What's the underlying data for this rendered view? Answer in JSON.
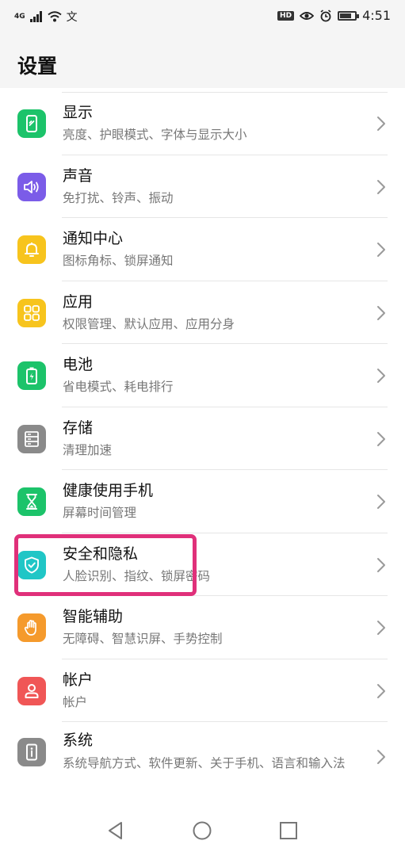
{
  "status_bar": {
    "network": "4G",
    "time": "4:51",
    "hd_label": "HD",
    "battery_level": 0.75,
    "icons": [
      "signal-icon",
      "wifi-icon",
      "translate-icon",
      "eye-icon",
      "alarm-icon",
      "battery-icon"
    ]
  },
  "header": {
    "title": "设置"
  },
  "settings": [
    {
      "id": "display",
      "title": "显示",
      "subtitle": "亮度、护眼模式、字体与显示大小",
      "icon": "display-icon",
      "color": "#1cc36a"
    },
    {
      "id": "sound",
      "title": "声音",
      "subtitle": "免打扰、铃声、振动",
      "icon": "speaker-icon",
      "color": "#7b5ce8"
    },
    {
      "id": "notify",
      "title": "通知中心",
      "subtitle": "图标角标、锁屏通知",
      "icon": "bell-icon",
      "color": "#f7c41d"
    },
    {
      "id": "apps",
      "title": "应用",
      "subtitle": "权限管理、默认应用、应用分身",
      "icon": "apps-grid-icon",
      "color": "#f7c41d"
    },
    {
      "id": "battery",
      "title": "电池",
      "subtitle": "省电模式、耗电排行",
      "icon": "battery-charge-icon",
      "color": "#1cc36a"
    },
    {
      "id": "storage",
      "title": "存储",
      "subtitle": "清理加速",
      "icon": "storage-icon",
      "color": "#8a8a8a"
    },
    {
      "id": "health",
      "title": "健康使用手机",
      "subtitle": "屏幕时间管理",
      "icon": "hourglass-icon",
      "color": "#1cc36a"
    },
    {
      "id": "security",
      "title": "安全和隐私",
      "subtitle": "人脸识别、指纹、锁屏密码",
      "icon": "shield-check-icon",
      "color": "#20c6c6"
    },
    {
      "id": "access",
      "title": "智能辅助",
      "subtitle": "无障碍、智慧识屏、手势控制",
      "icon": "hand-icon",
      "color": "#f59a2c"
    },
    {
      "id": "account",
      "title": "帐户",
      "subtitle": "帐户",
      "icon": "user-icon",
      "color": "#f05656"
    },
    {
      "id": "system",
      "title": "系统",
      "subtitle": "系统导航方式、软件更新、关于手机、语言和输入法",
      "icon": "info-phone-icon",
      "color": "#8a8a8a"
    }
  ],
  "nav_bar": {
    "icons": [
      "back-icon",
      "home-icon",
      "recents-icon"
    ]
  },
  "accent": {
    "highlight_border": "#e0307a"
  }
}
